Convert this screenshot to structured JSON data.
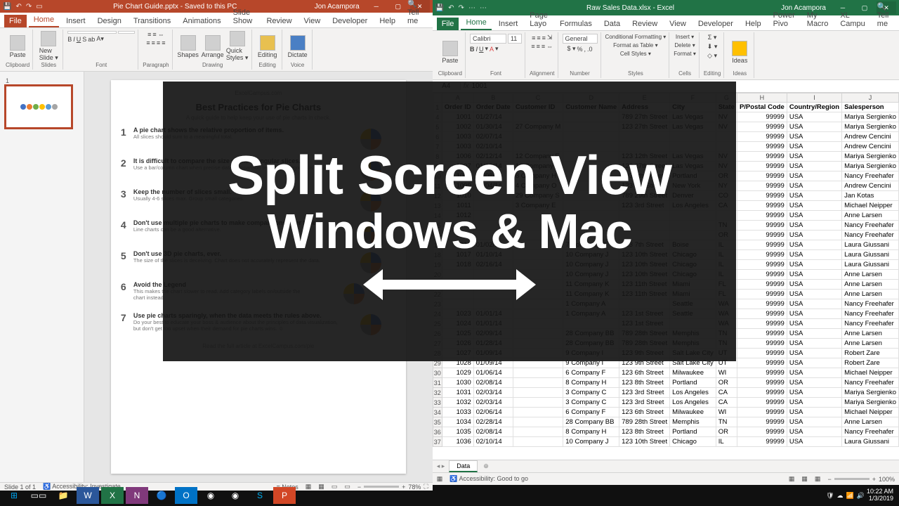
{
  "overlay": {
    "line1": "Split Screen View",
    "line2": "Windows & Mac"
  },
  "powerpoint": {
    "title": "Pie Chart Guide.pptx - Saved to this PC",
    "user": "Jon Acampora",
    "tabs": [
      "File",
      "Home",
      "Insert",
      "Design",
      "Transitions",
      "Animations",
      "Slide Show",
      "Review",
      "View",
      "Developer",
      "Help"
    ],
    "activeTab": "Home",
    "tell": "Tell me",
    "ribbonGroups": [
      "Clipboard",
      "Slides",
      "Font",
      "Paragraph",
      "Drawing",
      "Editing",
      "Voice"
    ],
    "slideTitle": "Best Practices for Pie Charts",
    "slideSource": "ExcelCampus.com",
    "slideSubtitle": "A quick guide to help keep your use of pie charts in check.",
    "tips": [
      {
        "n": "1",
        "h": "A pie chart shows the relative proportion of items.",
        "p": "All slices should sum to a meaningful total."
      },
      {
        "n": "2",
        "h": "It is difficult to compare the size of the triangular slices.",
        "p": "Use a bar/column chart when precise data comparison between categories is required."
      },
      {
        "n": "3",
        "h": "Keep the number of slices small.",
        "p": "Usually 4-6 slices max. Group small categories."
      },
      {
        "n": "4",
        "h": "Don't use multiple pie charts to make comparisons over time.",
        "p": "Line charts can be a good alternative."
      },
      {
        "n": "5",
        "h": "Don't use 3D pie charts, ever.",
        "p": "The size of the slices is deceiving. Chart does not accurately represent the data."
      },
      {
        "n": "6",
        "h": "Avoid the Legend",
        "p": "This makes the chart slower to read. Add category labels on/outside the chart instead."
      },
      {
        "n": "7",
        "h": "Use pie charts sparingly, when the data meets the rules above.",
        "p": "Do your best to educate your boss & audience about the principles of data visualization, but don't get too upset when their demand for pie charts wins. ☺"
      }
    ],
    "footerNote": "Read the full article at ExcelCampus.com/pie",
    "status": {
      "slide": "Slide 1 of 1",
      "access": "Accessibility: Investigate",
      "notes": "Notes",
      "zoom": "78%"
    }
  },
  "excel": {
    "title": "Raw Sales Data.xlsx - Excel",
    "user": "Jon Acampora",
    "tabs": [
      "File",
      "Home",
      "Insert",
      "Page Layo",
      "Formulas",
      "Data",
      "Review",
      "View",
      "Developer",
      "Help",
      "Power Pivo",
      "My Macro",
      "XL Campu"
    ],
    "activeTab": "Home",
    "tell": "Tell me",
    "ribbonGroups": [
      "Clipboard",
      "Font",
      "Alignment",
      "Number",
      "Styles",
      "Cells",
      "Editing",
      "Ideas"
    ],
    "font": "Calibri",
    "fontSize": "11",
    "numberFmt": "General",
    "styleBtns": [
      "Conditional Formatting ▾",
      "Format as Table ▾",
      "Cell Styles ▾"
    ],
    "cellBtns": [
      "Insert ▾",
      "Delete ▾",
      "Format ▾"
    ],
    "nameBox": "A4",
    "formula": "1001",
    "cols": [
      "",
      "A",
      "B",
      "C",
      "D",
      "E",
      "F",
      "G",
      "H",
      "I",
      "J"
    ],
    "headers": [
      "",
      "Order ID",
      "Order Date",
      "Customer ID",
      "Customer Name",
      "Address",
      "City",
      "State",
      "P/Postal Code",
      "Country/Region",
      "Salesperson"
    ],
    "rows": [
      [
        "4",
        "1001",
        "01/27/14",
        "",
        "",
        "789 27th Street",
        "Las Vegas",
        "NV",
        "99999",
        "USA",
        "Mariya Sergienko"
      ],
      [
        "5",
        "1002",
        "01/30/14",
        "27 Company M",
        "",
        "123 27th Street",
        "Las Vegas",
        "NV",
        "99999",
        "USA",
        "Mariya Sergienko"
      ],
      [
        "6",
        "1003",
        "02/07/14",
        "",
        "",
        "",
        "",
        "",
        "99999",
        "USA",
        "Andrew Cencini"
      ],
      [
        "7",
        "1003",
        "02/10/14",
        "",
        "",
        "",
        "",
        "",
        "99999",
        "USA",
        "Andrew Cencini"
      ],
      [
        "8",
        "1006",
        "02/12/14",
        "12 Company E",
        "",
        "123 12th Street",
        "Las Vegas",
        "NV",
        "99999",
        "USA",
        "Mariya Sergienko"
      ],
      [
        "9",
        "1007",
        "01/12/14",
        "12 Company L",
        "",
        "123 27th Street",
        "Las Vegas",
        "NV",
        "99999",
        "USA",
        "Mariya Sergienko"
      ],
      [
        "10",
        "1008",
        "01/08/14",
        "8 Company H",
        "",
        "123 8th Street",
        "Portland",
        "OR",
        "99999",
        "USA",
        "Nancy Freehafer"
      ],
      [
        "11",
        "1009",
        "02/04/14",
        "4 Company O",
        "",
        "123 4th Street",
        "New York",
        "NY",
        "99999",
        "USA",
        "Andrew Cencini"
      ],
      [
        "12",
        "1010",
        "",
        "29 Company S",
        "",
        "789 29th Street",
        "Denver",
        "CO",
        "99999",
        "USA",
        "Jan Kotas"
      ],
      [
        "13",
        "1011",
        "",
        "3 Company E",
        "",
        "123 3rd Street",
        "Los Angeles",
        "CA",
        "99999",
        "USA",
        "Michael Neipper"
      ],
      [
        "14",
        "1012",
        "",
        "",
        "",
        "",
        "",
        "",
        "99999",
        "USA",
        "Anne Larsen"
      ],
      [
        "15",
        "1013",
        "",
        "",
        "",
        "",
        "",
        "TN",
        "99999",
        "USA",
        "Nancy Freehafer"
      ],
      [
        "16",
        "1014",
        "",
        "",
        "",
        "",
        "",
        "OR",
        "99999",
        "USA",
        "Nancy Freehafer"
      ],
      [
        "17",
        "1016",
        "01/02/14",
        "",
        "7 Company G",
        "123 7th Street",
        "Boise",
        "IL",
        "99999",
        "USA",
        "Laura Giussani"
      ],
      [
        "18",
        "1017",
        "01/10/14",
        "",
        "10 Company J",
        "123 10th Street",
        "Chicago",
        "IL",
        "99999",
        "USA",
        "Laura Giussani"
      ],
      [
        "19",
        "1018",
        "02/16/14",
        "",
        "10 Company J",
        "123 10th Street",
        "Chicago",
        "IL",
        "99999",
        "USA",
        "Laura Giussani"
      ],
      [
        "20",
        "",
        "",
        "",
        "10 Company J",
        "123 10th Street",
        "Chicago",
        "IL",
        "99999",
        "USA",
        "Anne Larsen"
      ],
      [
        "21",
        "",
        "",
        "",
        "11 Company K",
        "123 11th Street",
        "Miami",
        "FL",
        "99999",
        "USA",
        "Anne Larsen"
      ],
      [
        "22",
        "",
        "",
        "",
        "11 Company K",
        "123 11th Street",
        "Miami",
        "FL",
        "99999",
        "USA",
        "Anne Larsen"
      ],
      [
        "23",
        "",
        "",
        "",
        "1 Company A",
        "",
        "Seattle",
        "WA",
        "99999",
        "USA",
        "Nancy Freehafer"
      ],
      [
        "24",
        "1023",
        "01/01/14",
        "",
        "1 Company A",
        "123 1st Street",
        "Seattle",
        "WA",
        "99999",
        "USA",
        "Nancy Freehafer"
      ],
      [
        "25",
        "1024",
        "01/01/14",
        "",
        "",
        "123 1st Street",
        "",
        "WA",
        "99999",
        "USA",
        "Nancy Freehafer"
      ],
      [
        "26",
        "1025",
        "02/09/14",
        "",
        "28 Company BB",
        "789 28th Street",
        "Memphis",
        "TN",
        "99999",
        "USA",
        "Anne Larsen"
      ],
      [
        "27",
        "1026",
        "01/28/14",
        "",
        "28 Company BB",
        "789 28th Street",
        "Memphis",
        "TN",
        "99999",
        "USA",
        "Anne Larsen"
      ],
      [
        "28",
        "1027",
        "01/09/14",
        "",
        "9 Company I",
        "123 9th Street",
        "Salt Lake City",
        "UT",
        "99999",
        "USA",
        "Robert Zare"
      ],
      [
        "29",
        "1028",
        "01/09/14",
        "",
        "9 Company I",
        "123 9th Street",
        "Salt Lake City",
        "UT",
        "99999",
        "USA",
        "Robert Zare"
      ],
      [
        "30",
        "1029",
        "01/06/14",
        "",
        "6 Company F",
        "123 6th Street",
        "Milwaukee",
        "WI",
        "99999",
        "USA",
        "Michael Neipper"
      ],
      [
        "31",
        "1030",
        "02/08/14",
        "",
        "8 Company H",
        "123 8th Street",
        "Portland",
        "OR",
        "99999",
        "USA",
        "Nancy Freehafer"
      ],
      [
        "32",
        "1031",
        "02/03/14",
        "",
        "3 Company C",
        "123 3rd Street",
        "Los Angeles",
        "CA",
        "99999",
        "USA",
        "Mariya Sergienko"
      ],
      [
        "33",
        "1032",
        "02/03/14",
        "",
        "3 Company C",
        "123 3rd Street",
        "Los Angeles",
        "CA",
        "99999",
        "USA",
        "Mariya Sergienko"
      ],
      [
        "34",
        "1033",
        "02/06/14",
        "",
        "6 Company F",
        "123 6th Street",
        "Milwaukee",
        "WI",
        "99999",
        "USA",
        "Michael Neipper"
      ],
      [
        "35",
        "1034",
        "02/28/14",
        "",
        "28 Company BB",
        "789 28th Street",
        "Memphis",
        "TN",
        "99999",
        "USA",
        "Anne Larsen"
      ],
      [
        "36",
        "1035",
        "02/08/14",
        "",
        "8 Company H",
        "123 8th Street",
        "Portland",
        "OR",
        "99999",
        "USA",
        "Nancy Freehafer"
      ],
      [
        "37",
        "1036",
        "02/10/14",
        "",
        "10 Company J",
        "123 10th Street",
        "Chicago",
        "IL",
        "99999",
        "USA",
        "Laura Giussani"
      ]
    ],
    "sheetTab": "Data",
    "status": {
      "access": "Accessibility: Good to go",
      "zoom": "100%"
    }
  },
  "taskbar": {
    "time": "10:22 AM",
    "date": "1/3/2019"
  }
}
